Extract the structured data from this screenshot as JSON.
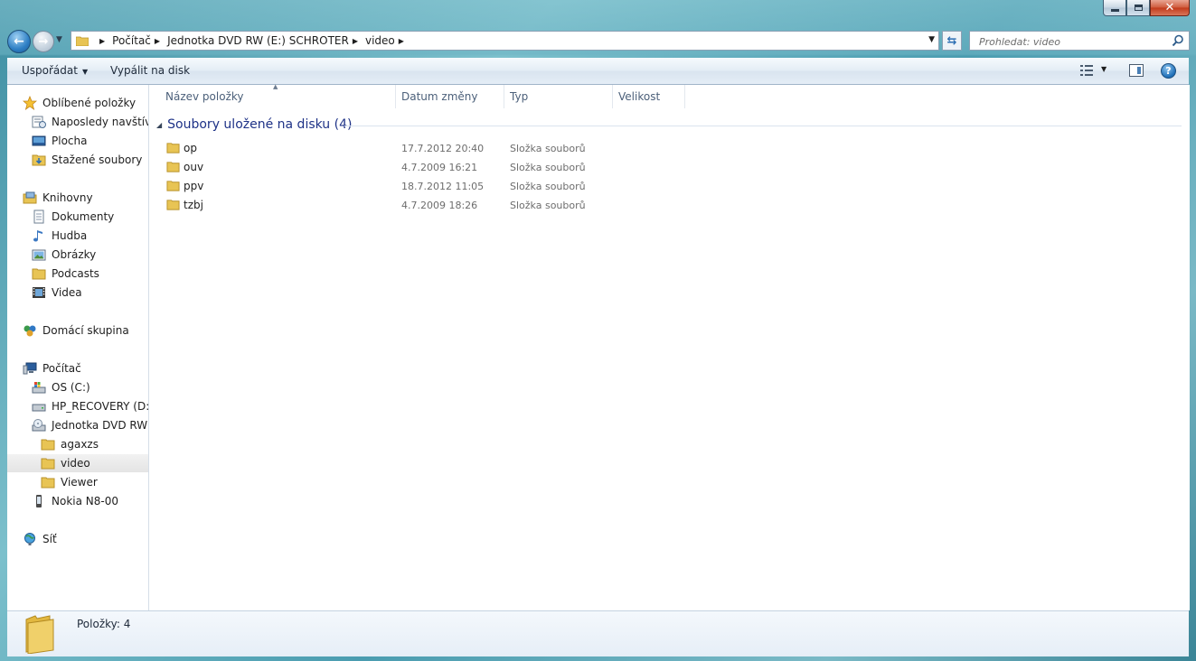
{
  "window": {
    "caption": {
      "minimize": "minimize",
      "maximize": "maximize",
      "close": "close"
    }
  },
  "address": {
    "breadcrumbs": [
      "Počítač",
      "Jednotka DVD RW (E:) SCHROTER",
      "video"
    ]
  },
  "search": {
    "placeholder": "Prohledat: video"
  },
  "toolbar": {
    "organize_label": "Uspořádat",
    "burn_label": "Vypálit na disk"
  },
  "sidebar": {
    "items": [
      {
        "label": "Oblíbené položky",
        "icon": "star-icon"
      },
      {
        "label": "Naposledy navštívené",
        "icon": "recent-places-icon"
      },
      {
        "label": "Plocha",
        "icon": "desktop-icon"
      },
      {
        "label": "Stažené soubory",
        "icon": "downloads-folder-icon"
      },
      {
        "label": "Knihovny",
        "icon": "libraries-icon"
      },
      {
        "label": "Dokumenty",
        "icon": "documents-icon"
      },
      {
        "label": "Hudba",
        "icon": "music-icon"
      },
      {
        "label": "Obrázky",
        "icon": "pictures-icon"
      },
      {
        "label": "Podcasts",
        "icon": "folder-icon"
      },
      {
        "label": "Videa",
        "icon": "videos-icon"
      },
      {
        "label": "Domácí skupina",
        "icon": "homegroup-icon"
      },
      {
        "label": "Počítač",
        "icon": "computer-icon"
      },
      {
        "label": "OS (C:)",
        "icon": "os-drive-icon"
      },
      {
        "label": "HP_RECOVERY (D:)",
        "icon": "hard-drive-icon"
      },
      {
        "label": "Jednotka DVD RW (E:) SCHROTER",
        "icon": "dvd-drive-icon"
      },
      {
        "label": "agaxzs",
        "icon": "folder-icon"
      },
      {
        "label": "video",
        "icon": "folder-icon",
        "selected": true
      },
      {
        "label": "Viewer",
        "icon": "folder-icon"
      },
      {
        "label": "Nokia N8-00",
        "icon": "phone-icon"
      },
      {
        "label": "Síť",
        "icon": "network-icon"
      }
    ]
  },
  "list": {
    "columns": [
      "Název položky",
      "Datum změny",
      "Typ",
      "Velikost"
    ],
    "group_title": "Soubory uložené na disku (4)",
    "rows": [
      {
        "name": "op",
        "date": "17.7.2012 20:40",
        "type": "Složka souborů",
        "size": ""
      },
      {
        "name": "ouv",
        "date": "4.7.2009 16:21",
        "type": "Složka souborů",
        "size": ""
      },
      {
        "name": "ppv",
        "date": "18.7.2012 11:05",
        "type": "Složka souborů",
        "size": ""
      },
      {
        "name": "tzbj",
        "date": "4.7.2009 18:26",
        "type": "Složka souborů",
        "size": ""
      }
    ]
  },
  "details": {
    "count": "Položky: 4"
  },
  "colors": {
    "accent": "#1e3287",
    "folder": "#e8c454",
    "selection": "#e8e8e8"
  }
}
